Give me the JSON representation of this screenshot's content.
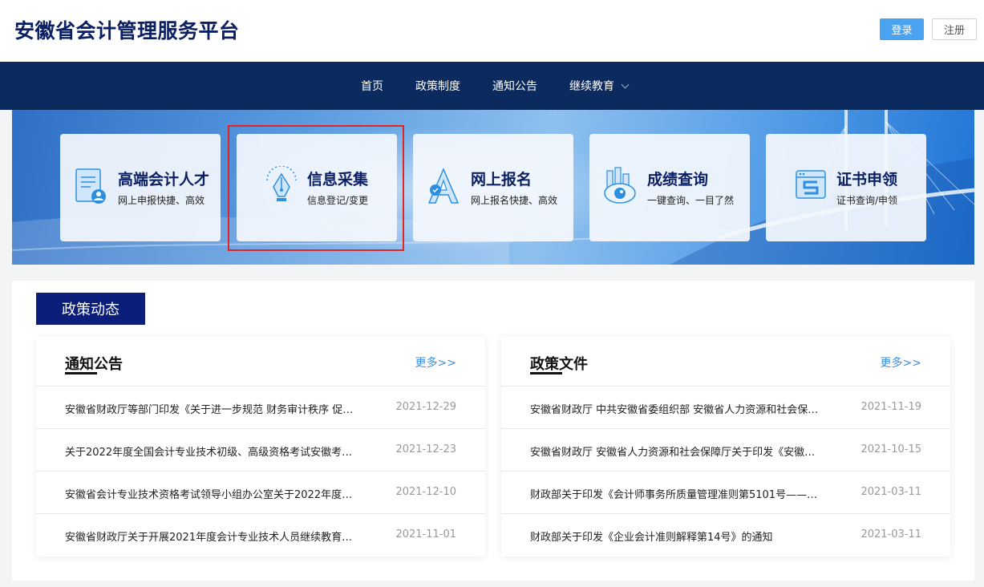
{
  "header": {
    "title": "安徽省会计管理服务平台",
    "login": "登录",
    "register": "注册"
  },
  "nav": {
    "items": [
      "首页",
      "政策制度",
      "通知公告",
      "继续教育"
    ]
  },
  "cards": [
    {
      "title": "高端会计人才",
      "subtitle": "网上申报快捷、高效",
      "icon": "document-person-icon"
    },
    {
      "title": "信息采集",
      "subtitle": "信息登记/变更",
      "icon": "pen-nib-icon"
    },
    {
      "title": "网上报名",
      "subtitle": "网上报名快捷、高效",
      "icon": "letter-a-icon"
    },
    {
      "title": "成绩查询",
      "subtitle": "一键查询、一目了然",
      "icon": "chart-eye-icon"
    },
    {
      "title": "证书申领",
      "subtitle": "证书查询/申领",
      "icon": "certificate-icon"
    }
  ],
  "section": {
    "tag": "政策动态"
  },
  "notices": {
    "title": "通知公告",
    "more": "更多>>",
    "items": [
      {
        "title": "安徽省财政厅等部门印发《关于进一步规范 财务审计秩序 促…",
        "date": "2021-12-29"
      },
      {
        "title": "关于2022年度全国会计专业技术初级、高级资格考试安徽考…",
        "date": "2021-12-23"
      },
      {
        "title": "安徽省会计专业技术资格考试领导小组办公室关于2022年度…",
        "date": "2021-12-10"
      },
      {
        "title": "安徽省财政厅关于开展2021年度会计专业技术人员继续教育…",
        "date": "2021-11-01"
      }
    ]
  },
  "policies": {
    "title": "政策文件",
    "more": "更多>>",
    "items": [
      {
        "title": "安徽省财政厅 中共安徽省委组织部 安徽省人力资源和社会保…",
        "date": "2021-11-19"
      },
      {
        "title": "安徽省财政厅 安徽省人力资源和社会保障厅关于印发《安徽…",
        "date": "2021-10-15"
      },
      {
        "title": "财政部关于印发《会计师事务所质量管理准则第5101号——…",
        "date": "2021-03-11"
      },
      {
        "title": "财政部关于印发《企业会计准则解释第14号》的通知",
        "date": "2021-03-11"
      }
    ]
  },
  "colors": {
    "brand": "#0b1f63",
    "nav": "#0b2a5e",
    "accent": "#4aa3f0",
    "highlight": "#e02525"
  }
}
